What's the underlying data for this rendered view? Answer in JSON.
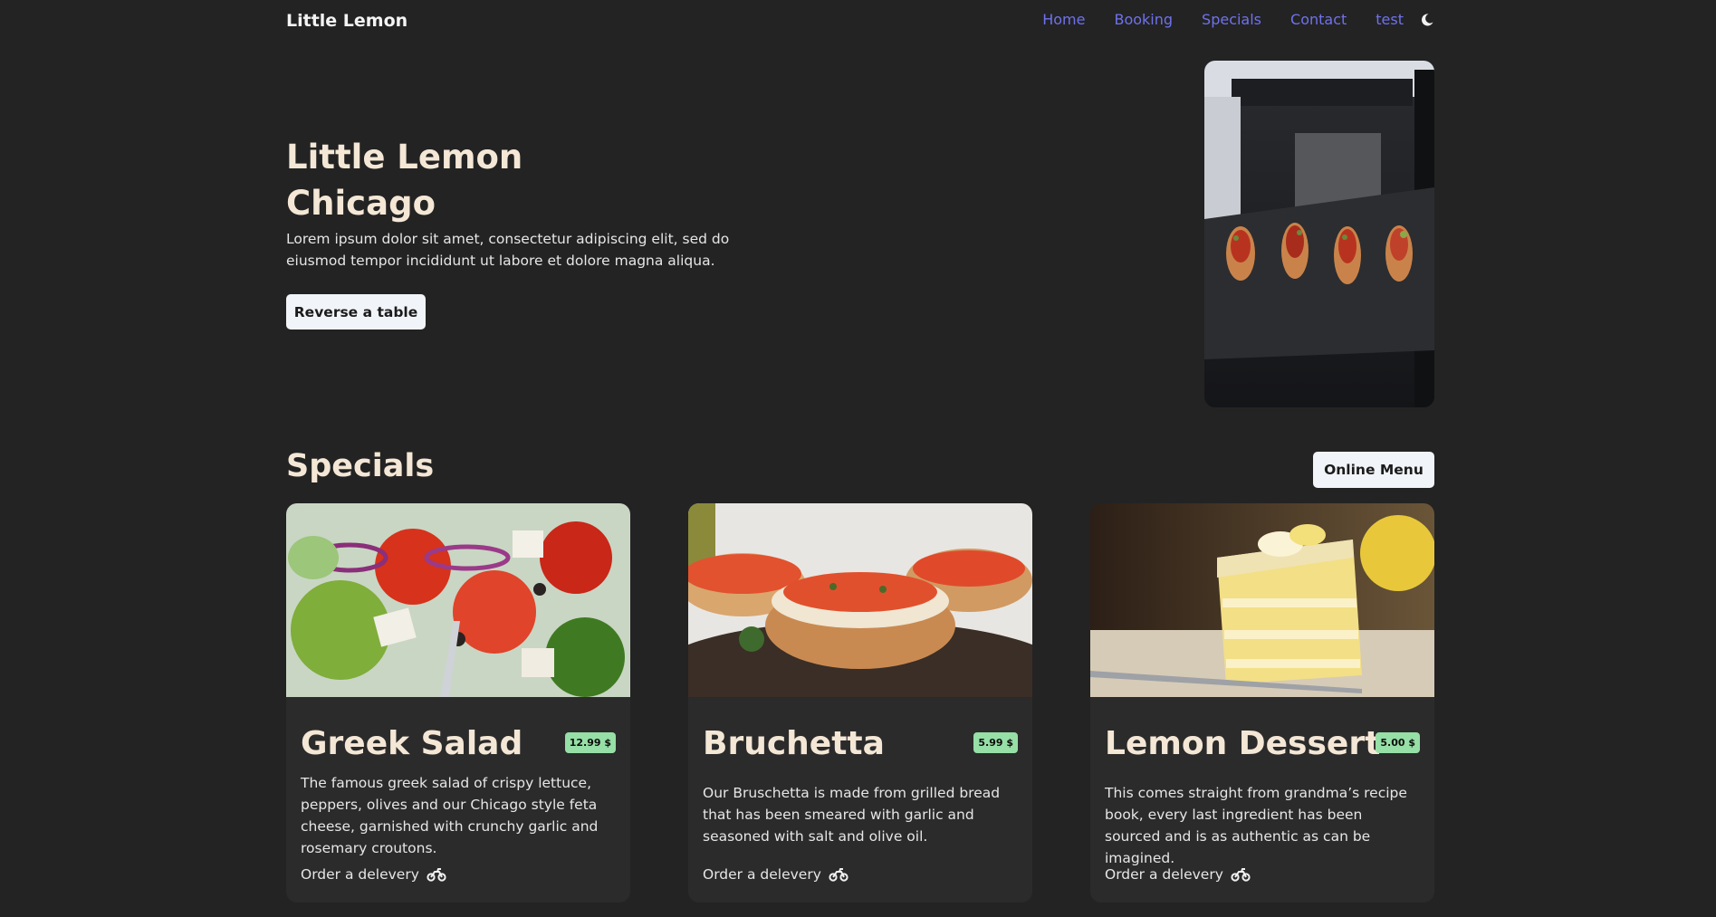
{
  "nav": {
    "brand": "Little Lemon",
    "links": [
      "Home",
      "Booking",
      "Specials",
      "Contact",
      "test"
    ],
    "theme_icon": "moon-icon"
  },
  "hero": {
    "title_line1": "Little Lemon",
    "title_line2": "Chicago",
    "description": "Lorem ipsum dolor sit amet, consectetur adipiscing elit, sed do eiusmod tempor incididunt ut labore et dolore magna aliqua.",
    "button_label": "Reverse a table"
  },
  "specials": {
    "title": "Specials",
    "menu_button": "Online Menu",
    "cards": [
      {
        "title": "Greek Salad",
        "price": "12.99 $",
        "description": "The famous greek salad of crispy lettuce, peppers, olives and our Chicago style feta cheese, garnished with crunchy garlic and rosemary croutons.",
        "order": "Order a delevery"
      },
      {
        "title": "Bruchetta",
        "price": "5.99 $",
        "description": "Our Bruschetta is made from grilled bread that has been smeared with garlic and seasoned with salt and olive oil.",
        "order": "Order a delevery"
      },
      {
        "title": "Lemon Dessert",
        "price": "5.00 $",
        "description": "This comes straight from grandma’s recipe book, every last ingredient has been sourced and is as authentic as can be imagined.",
        "order": "Order a delevery"
      }
    ]
  },
  "colors": {
    "background": "#232323",
    "card": "#2b2b2b",
    "link": "#6f72ec",
    "heading": "#f4e7d6",
    "price_badge": "#96dfa6"
  }
}
